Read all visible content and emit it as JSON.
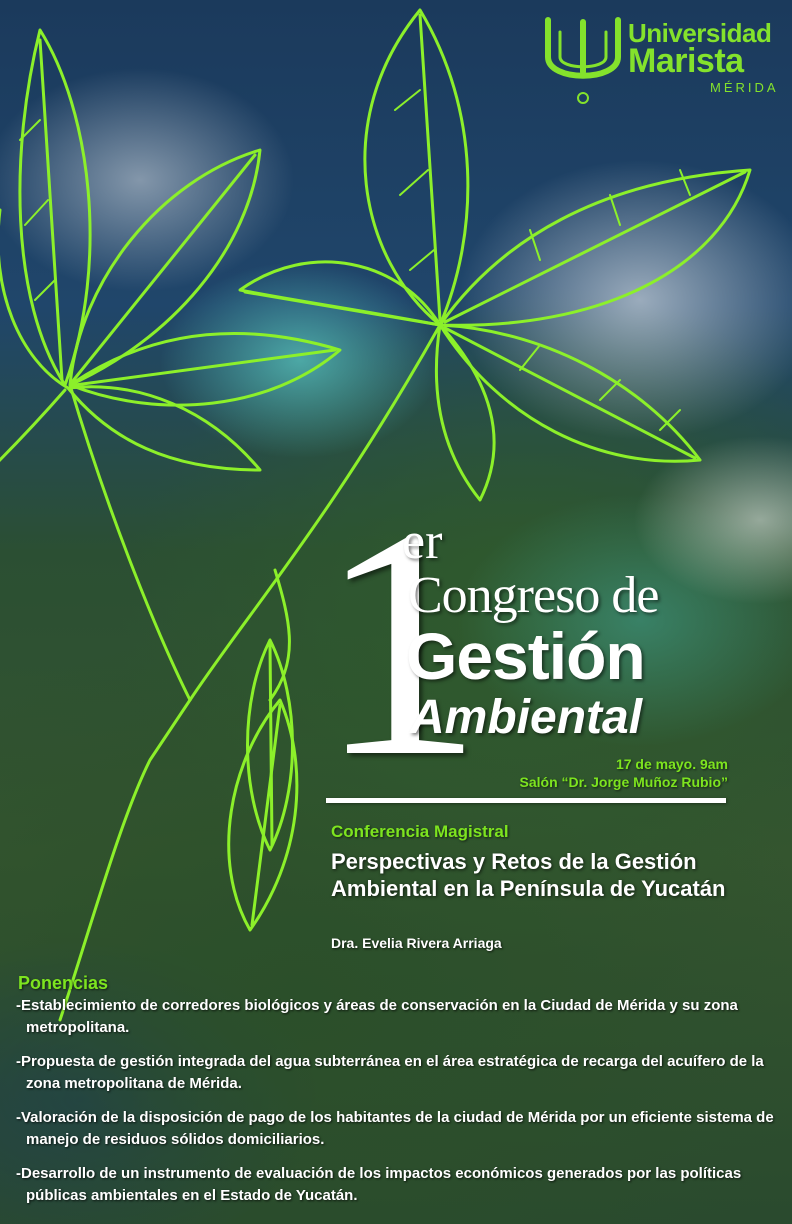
{
  "logo": {
    "line1": "Universidad",
    "line2": "Marista",
    "line3": "MÉRIDA",
    "icon": "marista-u-logo"
  },
  "title": {
    "number": "1",
    "ordinal": "er",
    "line1": "Congreso de",
    "line2": "Gestión",
    "line3": "Ambiental"
  },
  "event": {
    "date": "17 de mayo. 9am",
    "venue": "Salón “Dr. Jorge Muñoz Rubio”"
  },
  "conference": {
    "label": "Conferencia Magistral",
    "title": "Perspectivas y Retos de la Gestión Ambiental en la Península de Yucatán",
    "speaker": "Dra. Evelia Rivera Arriaga"
  },
  "ponencias": {
    "title": "Ponencias",
    "items": [
      "-Establecimiento de corredores biológicos y áreas de conservación en la Ciudad de Mérida y su zona metropolitana.",
      "-Propuesta de gestión integrada del agua subterránea en el área estratégica de recarga del acuífero de la zona metropolitana de Mérida.",
      "-Valoración de la disposición de pago de los habitantes de la ciudad de Mérida por un eficiente sistema de manejo de residuos sólidos domiciliarios.",
      "-Desarrollo de un instrumento de evaluación de los impactos económicos generados por las políticas públicas ambientales en el Estado de Yucatán."
    ]
  },
  "colors": {
    "accent_green": "#7de41f",
    "leaf_outline": "#8cf02a",
    "text": "#ffffff"
  }
}
